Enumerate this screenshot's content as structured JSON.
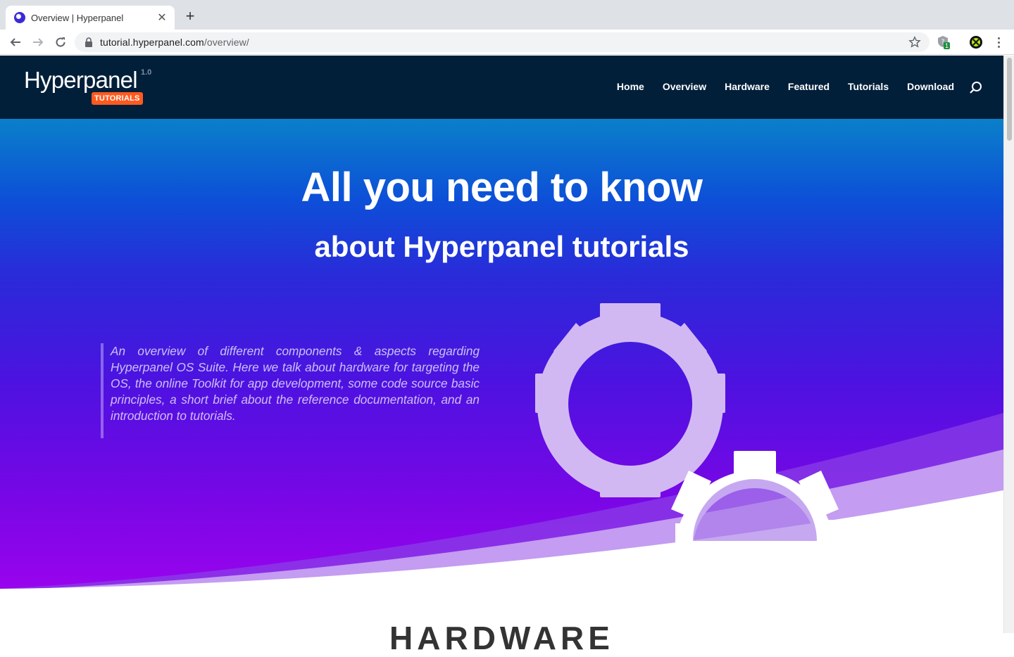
{
  "browser": {
    "tab_title": "Overview | Hyperpanel",
    "url_domain": "tutorial.hyperpanel.com",
    "url_path": "/overview/",
    "extension_badge": "1"
  },
  "site": {
    "logo_text": "Hyperpanel",
    "logo_version": "1.0",
    "logo_badge": "TUTORIALS",
    "nav": [
      "Home",
      "Overview",
      "Hardware",
      "Featured",
      "Tutorials",
      "Download"
    ]
  },
  "hero": {
    "title": "All you need to know",
    "subtitle": "about Hyperpanel tutorials",
    "quote": "An overview of different components & aspects regarding Hyperpanel OS Suite. Here we talk about hardware for targeting the OS, the online Toolkit for app development, some code source basic principles, a short brief about the reference documentation, and an introduction to tutorials."
  },
  "section": {
    "title": "HARDWARE"
  },
  "colors": {
    "header_bg": "#021f3a",
    "badge": "#ff5a1f",
    "gear": "#d2b8f3"
  }
}
